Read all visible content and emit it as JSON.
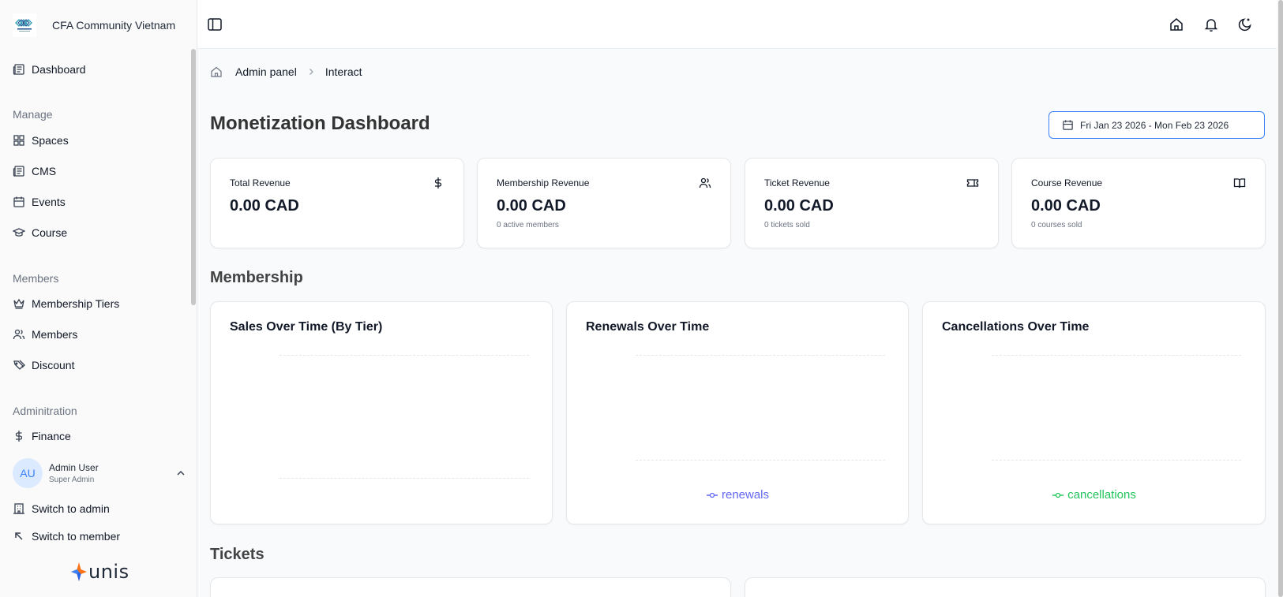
{
  "app": {
    "name": "CFA Community Vietnam"
  },
  "sidebar": {
    "dashboard": "Dashboard",
    "groups": {
      "manage": "Manage",
      "members": "Members",
      "administration": "Adminitration"
    },
    "items": {
      "spaces": "Spaces",
      "cms": "CMS",
      "events": "Events",
      "course": "Course",
      "membership_tiers": "Membership Tiers",
      "members": "Members",
      "discount": "Discount",
      "finance": "Finance"
    },
    "user": {
      "initials": "AU",
      "name": "Admin User",
      "role": "Super Admin"
    },
    "switch_admin": "Switch to admin",
    "switch_member": "Switch to member",
    "footer_brand": "unis"
  },
  "breadcrumb": {
    "items": [
      "Admin panel",
      "Interact"
    ]
  },
  "page": {
    "title": "Monetization Dashboard",
    "date_range": "Fri Jan 23 2026 - Mon Feb 23 2026"
  },
  "kpis": [
    {
      "label": "Total Revenue",
      "value": "0.00 CAD",
      "sub": "",
      "icon": "dollar-icon"
    },
    {
      "label": "Membership Revenue",
      "value": "0.00 CAD",
      "sub": "0 active members",
      "icon": "users-icon"
    },
    {
      "label": "Ticket Revenue",
      "value": "0.00 CAD",
      "sub": "0 tickets sold",
      "icon": "ticket-icon"
    },
    {
      "label": "Course Revenue",
      "value": "0.00 CAD",
      "sub": "0 courses sold",
      "icon": "book-icon"
    }
  ],
  "sections": {
    "membership": "Membership",
    "tickets": "Tickets"
  },
  "charts": {
    "sales": {
      "title": "Sales Over Time (By Tier)"
    },
    "renewals": {
      "title": "Renewals Over Time",
      "legend": "renewals",
      "color": "#6366f1"
    },
    "cancellations": {
      "title": "Cancellations Over Time",
      "legend": "cancellations",
      "color": "#22c55e"
    }
  },
  "chart_data": [
    {
      "type": "line",
      "title": "Sales Over Time (By Tier)",
      "series": []
    },
    {
      "type": "line",
      "title": "Renewals Over Time",
      "series": [
        {
          "name": "renewals",
          "values": []
        }
      ]
    },
    {
      "type": "line",
      "title": "Cancellations Over Time",
      "series": [
        {
          "name": "cancellations",
          "values": []
        }
      ]
    }
  ]
}
